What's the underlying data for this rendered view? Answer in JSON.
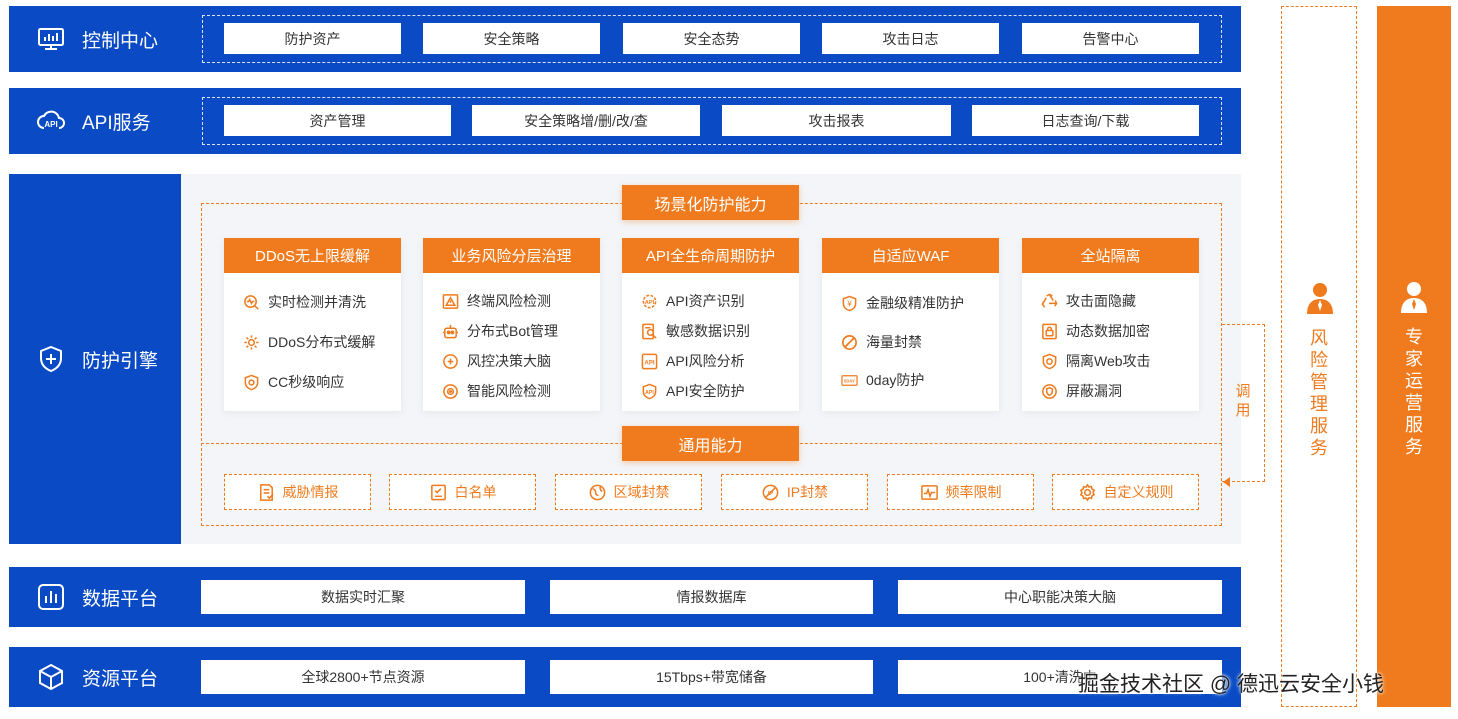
{
  "control_center": {
    "label": "控制中心",
    "icon": "monitor-chart-icon",
    "items": [
      "防护资产",
      "安全策略",
      "安全态势",
      "攻击日志",
      "告警中心"
    ]
  },
  "api_service": {
    "label": "API服务",
    "icon": "cloud-api-icon",
    "items": [
      "资产管理",
      "安全策略增/删/改/查",
      "攻击报表",
      "日志查询/下载"
    ]
  },
  "engine": {
    "label": "防护引擎",
    "icon": "shield-plus-icon",
    "scenario_title": "场景化防护能力",
    "general_title": "通用能力",
    "cards": [
      {
        "title": "DDoS无上限缓解",
        "items": [
          {
            "icon": "pulse-search-icon",
            "text": "实时检测并清洗"
          },
          {
            "icon": "gear-icon",
            "text": "DDoS分布式缓解"
          },
          {
            "icon": "shield-target-icon",
            "text": "CC秒级响应"
          }
        ]
      },
      {
        "title": "业务风险分层治理",
        "items": [
          {
            "icon": "warning-triangle-icon",
            "text": "终端风险检测"
          },
          {
            "icon": "robot-icon",
            "text": "分布式Bot管理"
          },
          {
            "icon": "brain-icon",
            "text": "风控决策大脑"
          },
          {
            "icon": "smart-detect-icon",
            "text": "智能风险检测"
          }
        ]
      },
      {
        "title": "API全生命周期防护",
        "items": [
          {
            "icon": "api-gear-icon",
            "text": "API资产识别"
          },
          {
            "icon": "data-search-icon",
            "text": "敏感数据识别"
          },
          {
            "icon": "api-box-icon",
            "text": "API风险分析"
          },
          {
            "icon": "api-shield-icon",
            "text": "API安全防护"
          }
        ]
      },
      {
        "title": "自适应WAF",
        "items": [
          {
            "icon": "yen-shield-icon",
            "text": "金融级精准防护"
          },
          {
            "icon": "ban-icon",
            "text": "海量封禁"
          },
          {
            "icon": "zero-day-icon",
            "text": "0day防护"
          }
        ]
      },
      {
        "title": "全站隔离",
        "items": [
          {
            "icon": "recycle-icon",
            "text": "攻击面隐藏"
          },
          {
            "icon": "lock-doc-icon",
            "text": "动态数据加密"
          },
          {
            "icon": "isolate-shield-icon",
            "text": "隔离Web攻击"
          },
          {
            "icon": "shield-circle-icon",
            "text": "屏蔽漏洞"
          }
        ]
      }
    ],
    "general_items": [
      {
        "icon": "threat-doc-icon",
        "text": "威胁情报"
      },
      {
        "icon": "checklist-icon",
        "text": "白名单"
      },
      {
        "icon": "globe-pin-icon",
        "text": "区域封禁"
      },
      {
        "icon": "ip-ban-icon",
        "text": "IP封禁"
      },
      {
        "icon": "frequency-icon",
        "text": "频率限制"
      },
      {
        "icon": "settings-gear-icon",
        "text": "自定义规则"
      }
    ]
  },
  "data_platform": {
    "label": "数据平台",
    "icon": "bar-chart-icon",
    "items": [
      "数据实时汇聚",
      "情报数据库",
      "中心职能决策大脑"
    ]
  },
  "resource_platform": {
    "label": "资源平台",
    "icon": "cube-icon",
    "items": [
      "全球2800+节点资源",
      "15Tbps+带宽储备",
      "100+清洗中"
    ]
  },
  "call_label": [
    "调",
    "用"
  ],
  "risk_service": [
    "风",
    "险",
    "管",
    "理",
    "服",
    "务"
  ],
  "expert_service": [
    "专",
    "家",
    "运",
    "营",
    "服",
    "务"
  ],
  "watermark": "掘金技术社区 @ 德迅云安全小钱",
  "colors": {
    "blue": "#0a4bc5",
    "orange": "#ef7b1e",
    "panel": "#f3f5f9"
  }
}
